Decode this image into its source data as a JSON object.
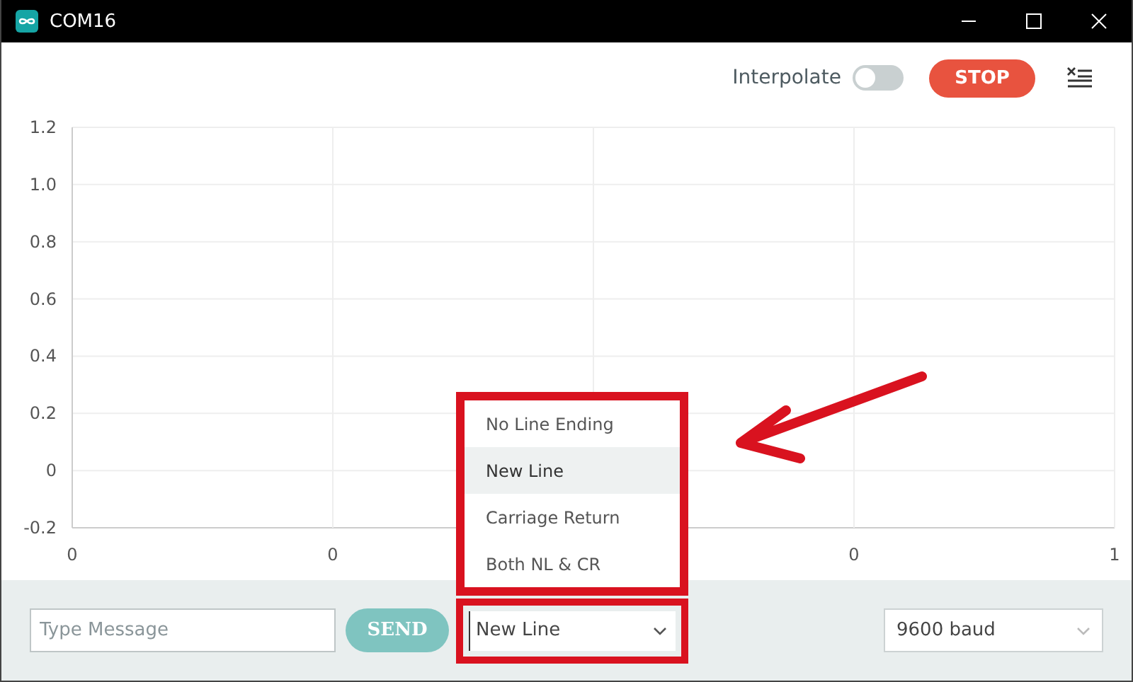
{
  "window": {
    "title": "COM16"
  },
  "toolbar": {
    "interpolate": {
      "label": "Interpolate",
      "on": false
    },
    "stop_button": "STOP"
  },
  "plot": {
    "chart_data": {
      "type": "line",
      "ylim": [
        -0.2,
        1.2
      ],
      "yticks": [
        {
          "value": 1.2,
          "label": "1.2"
        },
        {
          "value": 1.0,
          "label": "1.0"
        },
        {
          "value": 0.8,
          "label": "0.8"
        },
        {
          "value": 0.6,
          "label": "0.6"
        },
        {
          "value": 0.4,
          "label": "0.4"
        },
        {
          "value": 0.2,
          "label": "0.2"
        },
        {
          "value": 0,
          "label": "0"
        },
        {
          "value": -0.2,
          "label": "-0.2"
        }
      ],
      "categories": [
        "0",
        "0",
        null,
        "0",
        "1"
      ],
      "grid": true
    }
  },
  "footer": {
    "message": {
      "placeholder": "Type Message"
    },
    "send_button": "SEND",
    "line_ending": {
      "value": "New Line",
      "highlighted": true
    },
    "baud": {
      "value": "9600 baud"
    }
  },
  "line_ending_menu": {
    "highlighted": true,
    "items": [
      {
        "label": "No Line Ending",
        "selected": false
      },
      {
        "label": "New Line",
        "selected": true
      },
      {
        "label": "Carriage Return",
        "selected": false
      },
      {
        "label": "Both NL & CR",
        "selected": false
      }
    ]
  },
  "callout_arrow": {
    "shown": true,
    "color": "#d9121f"
  }
}
